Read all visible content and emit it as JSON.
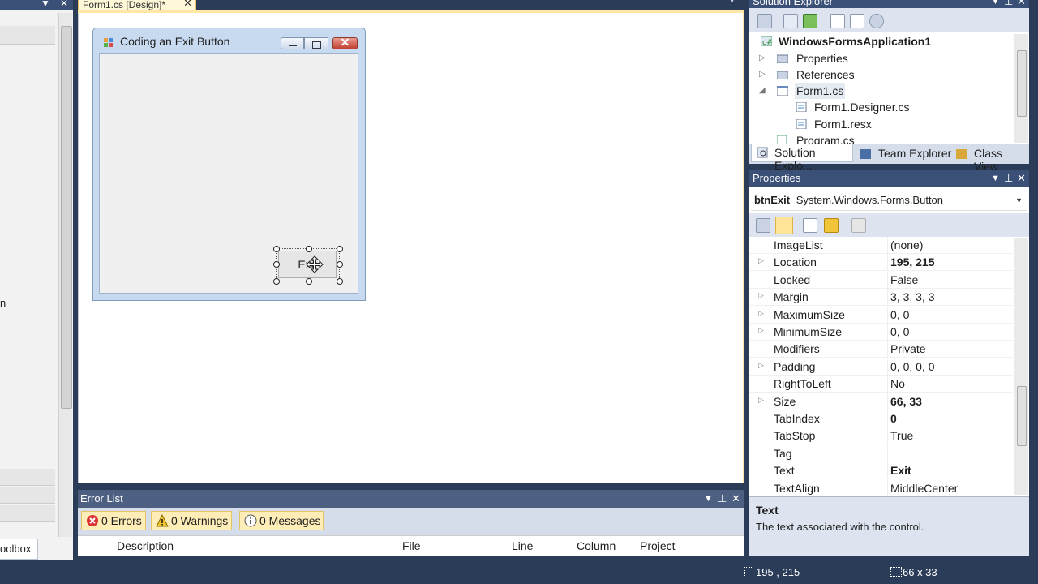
{
  "document_tab": {
    "label": "Form1.cs [Design]*",
    "close": "✕"
  },
  "form": {
    "title": "Coding an Exit Button",
    "button_label": "Exit",
    "close_glyph": "✕"
  },
  "error_list": {
    "title": "Error List",
    "filters": [
      {
        "label": "0 Errors",
        "icon": "error-icon"
      },
      {
        "label": "0 Warnings",
        "icon": "warning-icon"
      },
      {
        "label": "0 Messages",
        "icon": "info-icon"
      }
    ],
    "columns": [
      "Description",
      "File",
      "Line",
      "Column",
      "Project"
    ]
  },
  "left_panel": {
    "toolbox_label": "oolbox",
    "fragment": "n"
  },
  "solution_explorer": {
    "title": "Solution Explorer",
    "tree": [
      {
        "label": "WindowsFormsApplication1",
        "bold": true
      },
      {
        "label": "Properties"
      },
      {
        "label": "References"
      },
      {
        "label": "Form1.cs"
      },
      {
        "label": "Form1.Designer.cs"
      },
      {
        "label": "Form1.resx"
      },
      {
        "label": "Program.cs"
      }
    ],
    "tabs": [
      "Solution Explo...",
      "Team Explorer",
      "Class View"
    ]
  },
  "properties": {
    "title": "Properties",
    "object_name": "btnExit",
    "object_type": "System.Windows.Forms.Button",
    "rows": [
      {
        "name": "ImageList",
        "value": "(none)",
        "expandable": false,
        "bold": false
      },
      {
        "name": "Location",
        "value": "195, 215",
        "expandable": true,
        "bold": true
      },
      {
        "name": "Locked",
        "value": "False",
        "expandable": false,
        "bold": false
      },
      {
        "name": "Margin",
        "value": "3, 3, 3, 3",
        "expandable": true,
        "bold": false
      },
      {
        "name": "MaximumSize",
        "value": "0, 0",
        "expandable": true,
        "bold": false
      },
      {
        "name": "MinimumSize",
        "value": "0, 0",
        "expandable": true,
        "bold": false
      },
      {
        "name": "Modifiers",
        "value": "Private",
        "expandable": false,
        "bold": false
      },
      {
        "name": "Padding",
        "value": "0, 0, 0, 0",
        "expandable": true,
        "bold": false
      },
      {
        "name": "RightToLeft",
        "value": "No",
        "expandable": false,
        "bold": false
      },
      {
        "name": "Size",
        "value": "66, 33",
        "expandable": true,
        "bold": true
      },
      {
        "name": "TabIndex",
        "value": "0",
        "expandable": false,
        "bold": true
      },
      {
        "name": "TabStop",
        "value": "True",
        "expandable": false,
        "bold": false
      },
      {
        "name": "Tag",
        "value": "",
        "expandable": false,
        "bold": false
      },
      {
        "name": "Text",
        "value": "Exit",
        "expandable": false,
        "bold": true
      },
      {
        "name": "TextAlign",
        "value": "MiddleCenter",
        "expandable": false,
        "bold": false
      }
    ],
    "description_title": "Text",
    "description_text": "The text associated with the control."
  },
  "status_bar": {
    "location": "195 , 215",
    "size": "66 x 33"
  },
  "pane_controls": {
    "dropdown": "▼",
    "pin": "⊥",
    "close": "✕"
  },
  "colors": {
    "accent": "#3b5077",
    "tab_active": "#ffedb8",
    "background": "#2b3c59"
  }
}
